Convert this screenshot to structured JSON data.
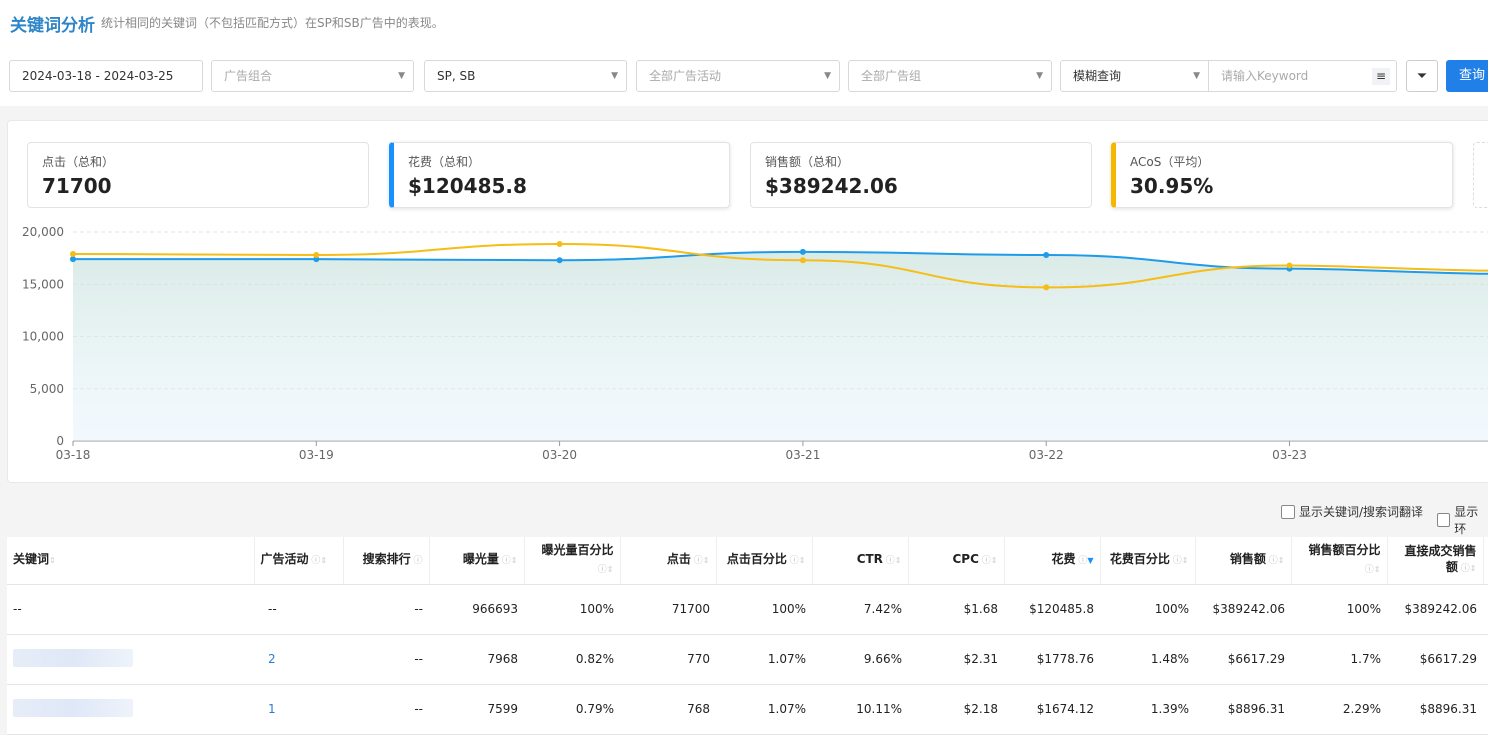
{
  "header": {
    "title": "关键词分析",
    "subtitle": "统计相同的关键词（不包括匹配方式）在SP和SB广告中的表现。"
  },
  "filters": {
    "date_range": "2024-03-18 - 2024-03-25",
    "portfolio_placeholder": "广告组合",
    "ad_type": "SP, SB",
    "campaign_placeholder": "全部广告活动",
    "adgroup_placeholder": "全部广告组",
    "match_mode": "模糊查询",
    "keyword_placeholder": "请输入Keyword",
    "search_label": "查询"
  },
  "kpis": [
    {
      "label": "点击（总和）",
      "value": "71700"
    },
    {
      "label": "花费（总和）",
      "value": "$120485.8",
      "accent": "#1890ff"
    },
    {
      "label": "销售额（总和）",
      "value": "$389242.06"
    },
    {
      "label": "ACoS（平均）",
      "value": "30.95%",
      "accent": "#f5b800"
    }
  ],
  "chart_data": {
    "type": "line",
    "categories": [
      "03-18",
      "03-19",
      "03-20",
      "03-21",
      "03-22",
      "03-23"
    ],
    "yticks": [
      "0",
      "5,000",
      "10,000",
      "15,000",
      "20,000"
    ],
    "ylim": [
      0,
      20000
    ],
    "grid": true,
    "series": [
      {
        "color": "#1e9be9",
        "values": [
          17400,
          17400,
          17300,
          18100,
          17800,
          16500
        ]
      },
      {
        "color": "#f6bd16",
        "values": [
          17900,
          17800,
          18850,
          17300,
          14700,
          16800
        ]
      }
    ]
  },
  "options": {
    "show_translation": "显示关键词/搜索词翻译",
    "show_other": "显示环"
  },
  "table": {
    "columns": [
      "关键词",
      "广告活动",
      "搜索排行",
      "曝光量",
      "曝光量百分比",
      "点击",
      "点击百分比",
      "CTR",
      "CPC",
      "花费",
      "花费百分比",
      "销售额",
      "销售额百分比",
      "直接成交销售额"
    ],
    "rows": [
      [
        "--",
        "--",
        "--",
        "966693",
        "100%",
        "71700",
        "100%",
        "7.42%",
        "$1.68",
        "$120485.8",
        "100%",
        "$389242.06",
        "100%",
        "$389242.06"
      ],
      [
        "",
        "2",
        "--",
        "7968",
        "0.82%",
        "770",
        "1.07%",
        "9.66%",
        "$2.31",
        "$1778.76",
        "1.48%",
        "$6617.29",
        "1.7%",
        "$6617.29"
      ],
      [
        "",
        "1",
        "--",
        "7599",
        "0.79%",
        "768",
        "1.07%",
        "10.11%",
        "$2.18",
        "$1674.12",
        "1.39%",
        "$8896.31",
        "2.29%",
        "$8896.31"
      ]
    ]
  }
}
